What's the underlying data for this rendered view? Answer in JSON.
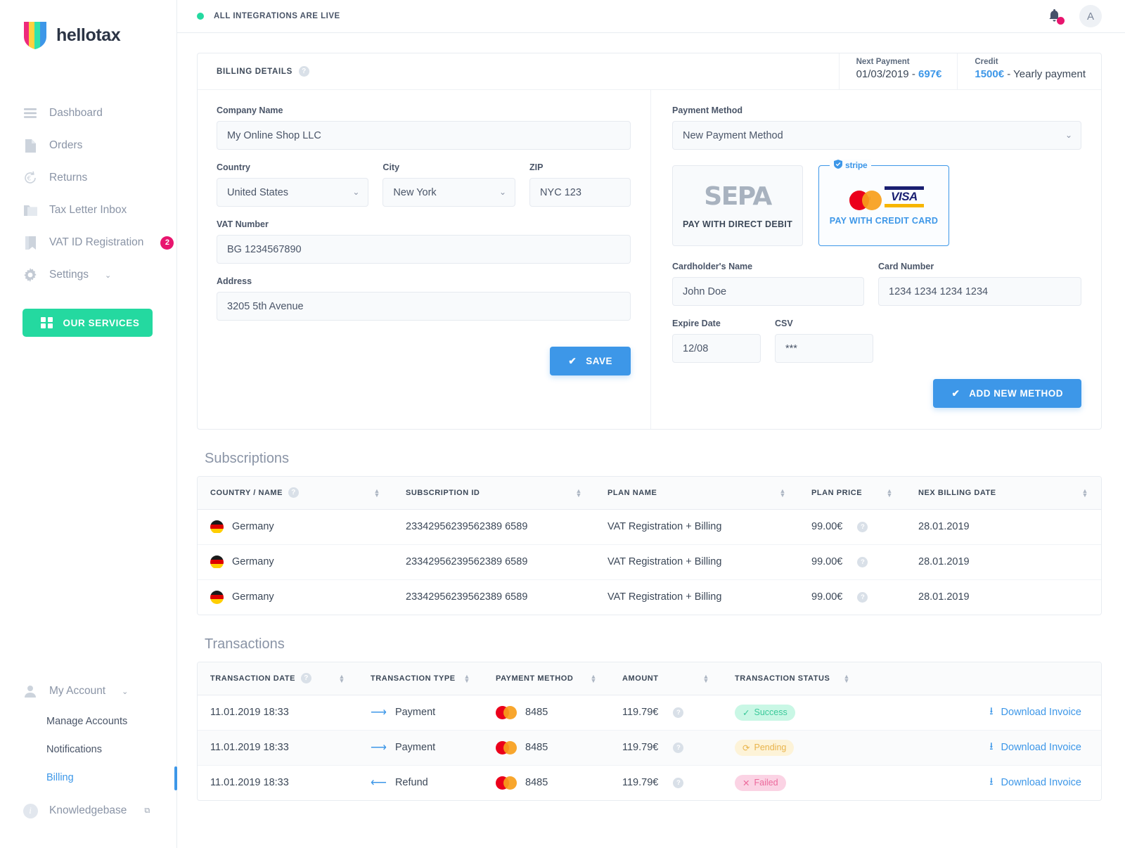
{
  "brand": {
    "name": "hellotax",
    "accent": "#3d97e8",
    "green": "#24d9a0",
    "pink": "#e8156e"
  },
  "sidebar": {
    "nav": [
      {
        "label": "Dashboard",
        "icon": "menu-icon"
      },
      {
        "label": "Orders",
        "icon": "document-icon"
      },
      {
        "label": "Returns",
        "icon": "euro-refresh-icon"
      },
      {
        "label": "Tax Letter Inbox",
        "icon": "folder-icon"
      },
      {
        "label": "VAT ID Registration",
        "icon": "bookmark-icon",
        "badge": "2"
      },
      {
        "label": "Settings",
        "icon": "gear-icon",
        "caret": "⌄"
      }
    ],
    "services_button": "OUR SERVICES",
    "account": {
      "label": "My Account",
      "caret": "⌄",
      "items": [
        {
          "label": "Manage Accounts",
          "active": false
        },
        {
          "label": "Notifications",
          "active": false
        },
        {
          "label": "Billing",
          "active": true
        }
      ]
    },
    "knowledgebase": {
      "label": "Knowledgebase",
      "external": "⧉"
    }
  },
  "topbar": {
    "status_text": "ALL INTEGRATIONS ARE LIVE",
    "bell": "notification-bell-icon",
    "avatar_initial": "A"
  },
  "billing": {
    "title": "BILLING DETAILS",
    "help": "?",
    "next_payment": {
      "label": "Next Payment",
      "date": "01/03/2019",
      "separator": " - ",
      "amount": "697€"
    },
    "credit": {
      "label": "Credit",
      "amount": "1500€",
      "suffix": " - Yearly payment"
    },
    "form": {
      "company_name": {
        "label": "Company Name",
        "value": "My Online Shop LLC"
      },
      "country": {
        "label": "Country",
        "value": "United States"
      },
      "city": {
        "label": "City",
        "value": "New York"
      },
      "zip": {
        "label": "ZIP",
        "value": "NYC 123"
      },
      "vat_number": {
        "label": "VAT Number",
        "value": "BG 1234567890"
      },
      "address": {
        "label": "Address",
        "value": "3205 5th Avenue"
      },
      "save_button": "SAVE"
    },
    "payment": {
      "method_label": "Payment Method",
      "method_value": "New Payment Method",
      "tiles": [
        {
          "logo": "SEPA",
          "caption": "PAY WITH DIRECT DEBIT",
          "selected": false
        },
        {
          "logo": "mastercard-visa",
          "caption": "PAY WITH CREDIT CARD",
          "selected": true,
          "tag": "stripe"
        }
      ],
      "cardholder": {
        "label": "Cardholder's Name",
        "value": "John Doe"
      },
      "card_number": {
        "label": "Card Number",
        "value": "1234 1234 1234 1234"
      },
      "expire": {
        "label": "Expire Date",
        "value": "12/08"
      },
      "csv": {
        "label": "CSV",
        "value": "***"
      },
      "add_button": "ADD NEW METHOD"
    }
  },
  "subscriptions": {
    "title": "Subscriptions",
    "columns": [
      "COUNTRY / NAME",
      "SUBSCRIPTION ID",
      "PLAN NAME",
      "PLAN PRICE",
      "NEX BILLING DATE"
    ],
    "rows": [
      {
        "country": "Germany",
        "flag": "de",
        "subscription_id": "23342956239562389 6589",
        "plan_name": "VAT Registration + Billing",
        "plan_price": "99.00€",
        "next_billing_date": "28.01.2019"
      },
      {
        "country": "Germany",
        "flag": "de",
        "subscription_id": "23342956239562389 6589",
        "plan_name": "VAT Registration + Billing",
        "plan_price": "99.00€",
        "next_billing_date": "28.01.2019"
      },
      {
        "country": "Germany",
        "flag": "de",
        "subscription_id": "23342956239562389 6589",
        "plan_name": "VAT Registration + Billing",
        "plan_price": "99.00€",
        "next_billing_date": "28.01.2019"
      }
    ]
  },
  "transactions": {
    "title": "Transactions",
    "columns": [
      "TRANSACTION DATE",
      "TRANSACTION TYPE",
      "PAYMENT METHOD",
      "AMOUNT",
      "TRANSACTION STATUS",
      ""
    ],
    "download_label": "Download Invoice",
    "rows": [
      {
        "date": "11.01.2019  18:33",
        "type": "Payment",
        "type_icon": "arrow-right-icon",
        "method_logo": "mastercard",
        "method_last4": "8485",
        "amount": "119.79€",
        "status": "Success",
        "status_kind": "success",
        "status_icon": "✓"
      },
      {
        "date": "11.01.2019  18:33",
        "type": "Payment",
        "type_icon": "arrow-right-icon",
        "method_logo": "mastercard",
        "method_last4": "8485",
        "amount": "119.79€",
        "status": "Pending",
        "status_kind": "pending",
        "status_icon": "⟳"
      },
      {
        "date": "11.01.2019  18:33",
        "type": "Refund",
        "type_icon": "arrow-left-icon",
        "method_logo": "mastercard",
        "method_last4": "8485",
        "amount": "119.79€",
        "status": "Failed",
        "status_kind": "failed",
        "status_icon": "✕"
      }
    ]
  }
}
